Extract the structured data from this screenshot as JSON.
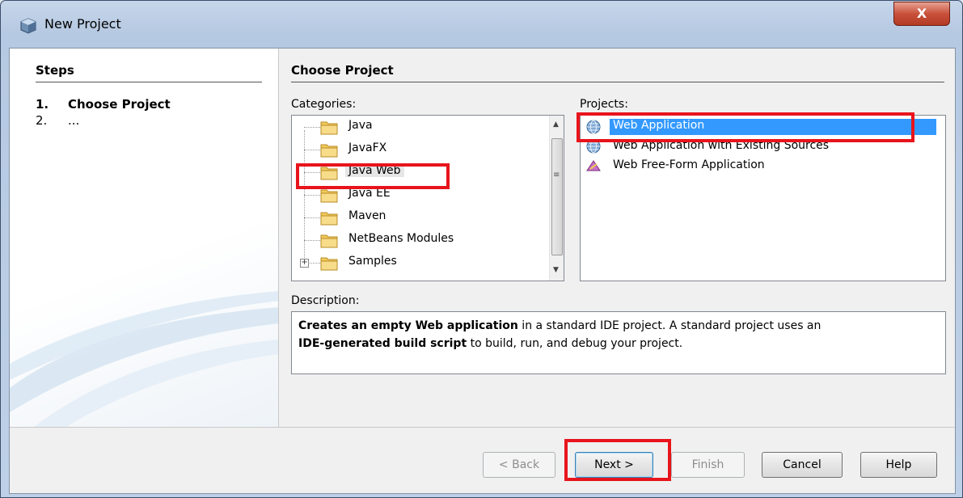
{
  "window": {
    "title": "New Project",
    "close_label": "X"
  },
  "steps": {
    "title": "Steps",
    "items": [
      {
        "num": "1.",
        "label": "Choose Project"
      },
      {
        "num": "2.",
        "label": "..."
      }
    ]
  },
  "main": {
    "title": "Choose Project",
    "categories_label": "Categories:",
    "projects_label": "Projects:",
    "description_label": "Description:"
  },
  "categories": [
    {
      "label": "Java"
    },
    {
      "label": "JavaFX"
    },
    {
      "label": "Java Web"
    },
    {
      "label": "Java EE"
    },
    {
      "label": "Maven"
    },
    {
      "label": "NetBeans Modules"
    },
    {
      "label": "Samples"
    }
  ],
  "projects": [
    {
      "label": "Web Application",
      "icon": "globe-icon"
    },
    {
      "label": "Web Application with Existing Sources",
      "icon": "globe-icon"
    },
    {
      "label": "Web Free-Form Application",
      "icon": "freeform-icon"
    }
  ],
  "description": {
    "bold1": "Creates an empty Web application",
    "text1": " in a standard IDE project. A standard project uses an",
    "bold2": "IDE-generated build script",
    "text2": " to build, run, and debug your project."
  },
  "buttons": {
    "back": "< Back",
    "next": "Next >",
    "finish": "Finish",
    "cancel": "Cancel",
    "help": "Help"
  },
  "colors": {
    "selection": "#3399ff",
    "highlight_box": "#e8141c"
  }
}
